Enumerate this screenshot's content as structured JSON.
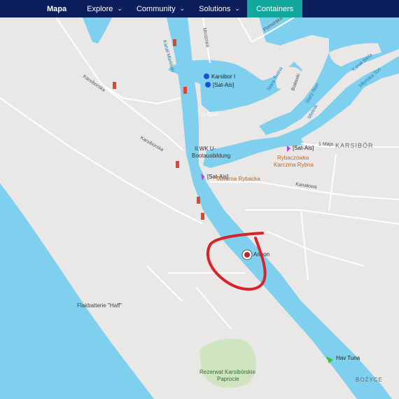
{
  "nav": {
    "brand": "Mapa",
    "items": [
      {
        "label": "Explore",
        "dropdown": true
      },
      {
        "label": "Community",
        "dropdown": true
      },
      {
        "label": "Solutions",
        "dropdown": true
      },
      {
        "label": "Containers",
        "dropdown": false,
        "active": true
      }
    ]
  },
  "colors": {
    "nav_bg": "#0c1f5c",
    "nav_active": "#13a89e",
    "water": "#7fd0ef",
    "land": "#e9e8e6",
    "park": "#cfe5c0",
    "annotation": "#d9232a"
  },
  "map": {
    "vessels": [
      {
        "label": "Karsibor I",
        "icon": "blue-circle-marker"
      },
      {
        "label": "[Sat-Ais]",
        "icon": "blue-circle-marker"
      },
      {
        "label": "[Sat-Ais]",
        "icon": "purple-vessel-marker"
      },
      {
        "label": "[Sat-Ais]",
        "icon": "purple-vessel-marker"
      },
      {
        "label": "Angon",
        "icon": "selected-vessel-marker"
      },
      {
        "label": "Hav Tuna",
        "icon": "green-vessel-marker"
      }
    ],
    "places": {
      "ubootbunker": "U-Boot",
      "bootausbildung_1": "II.WK U-",
      "bootausbildung_2": "Bootausbildung",
      "tawerna": "Tawerna Rybacka",
      "rybaczowka_1": "Rybaczówka",
      "rybaczowka_2": "Karczma Rybna",
      "flak": "Flakbatterie \"Haff\"",
      "rezerwat_1": "Rezerwat Karsibórskie",
      "rezerwat_2": "Paprocie",
      "karsibor": "KARSIBÓR",
      "bozyce": "BOŻYCE"
    },
    "streets": {
      "karsiborska_1": "Karsiborska",
      "karsiborska_2": "Karsiborska",
      "mostowa": "Mostowa",
      "pomorska": "Pomorska",
      "kanalowa": "Kanałowa",
      "maja": "1 Maja",
      "kanal_mielinski": "Kanał Mieliński",
      "stara_swina": "Stara Świna",
      "bialawki": "Białawki",
      "stary_nurt": "Stary Nurt",
      "mielnik": "Mielnik",
      "kanal_bilda": "Kanał Bilda",
      "mlynska_struga": "Młyńska Toń"
    }
  }
}
